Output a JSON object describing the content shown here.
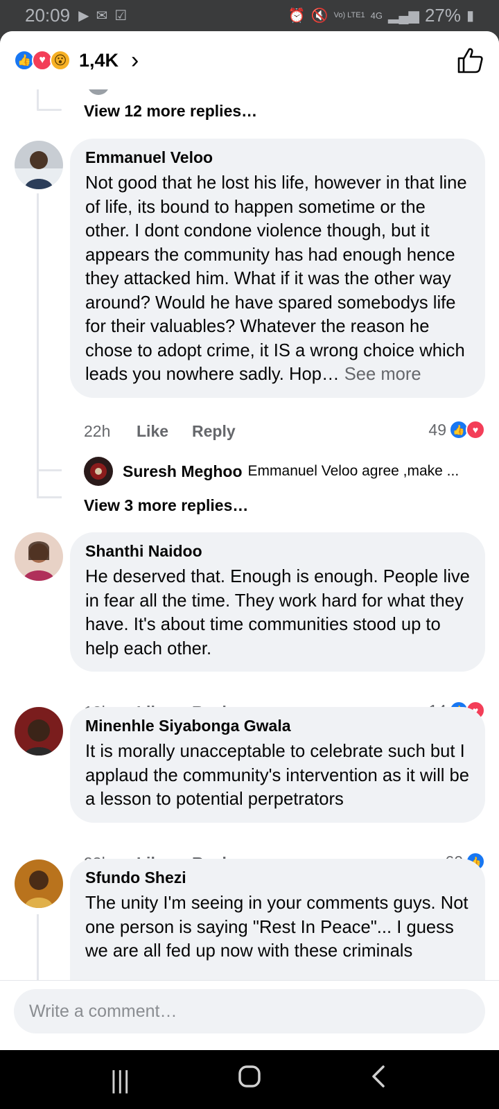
{
  "status_bar": {
    "time": "20:09",
    "network_label": "Vo) LTE1",
    "network_type": "4G",
    "battery": "27%"
  },
  "header": {
    "reactions": [
      "like",
      "love",
      "wow"
    ],
    "reaction_count": "1,4K",
    "chevron": "›"
  },
  "thread": {
    "view_more_top": "View 12 more replies…",
    "comments": [
      {
        "author": "Emmanuel Veloo",
        "text": "Not good that he lost his life, however in that line of life, its bound to happen sometime or the other. I dont condone violence though, but it appears the community has had enough hence they attacked him. What if it was the other way around? Would he have spared somebodys life for their valuables? Whatever the reason he chose to adopt crime, it IS a wrong choice which leads you nowhere sadly. Hop…",
        "see_more": "See more",
        "time": "22h",
        "like_label": "Like",
        "reply_label": "Reply",
        "reaction_count": "49",
        "reactions": [
          "like",
          "love"
        ],
        "reply_preview": {
          "author": "Suresh Meghoo",
          "text": "Emmanuel Veloo agree ,make ..."
        },
        "view_more_replies": "View 3 more replies…"
      },
      {
        "author": "Shanthi Naidoo",
        "text": "He deserved that. Enough is enough. People live in fear all the time. They work hard for what they have. It's about time communities stood up to help each other.",
        "time": "13h",
        "like_label": "Like",
        "reply_label": "Reply",
        "reaction_count": "14",
        "reactions": [
          "like",
          "love"
        ]
      },
      {
        "author": "Minenhle Siyabonga Gwala",
        "text": "It is morally unacceptable to celebrate such but I applaud the community's intervention as it will be a lesson to potential perpetrators",
        "time": "23h",
        "like_label": "Like",
        "reply_label": "Reply",
        "reaction_count": "60",
        "reactions": [
          "like"
        ]
      },
      {
        "author": "Sfundo Shezi",
        "text": "The unity I'm seeing in your comments guys. Not one person is saying \"Rest In Peace\"... I guess we are all fed up now with these criminals"
      }
    ]
  },
  "composer": {
    "placeholder": "Write a comment…"
  },
  "colors": {
    "like": "#1877f2",
    "love": "#f33e58",
    "bubble": "#f0f2f5",
    "muted_text": "#65676b"
  }
}
